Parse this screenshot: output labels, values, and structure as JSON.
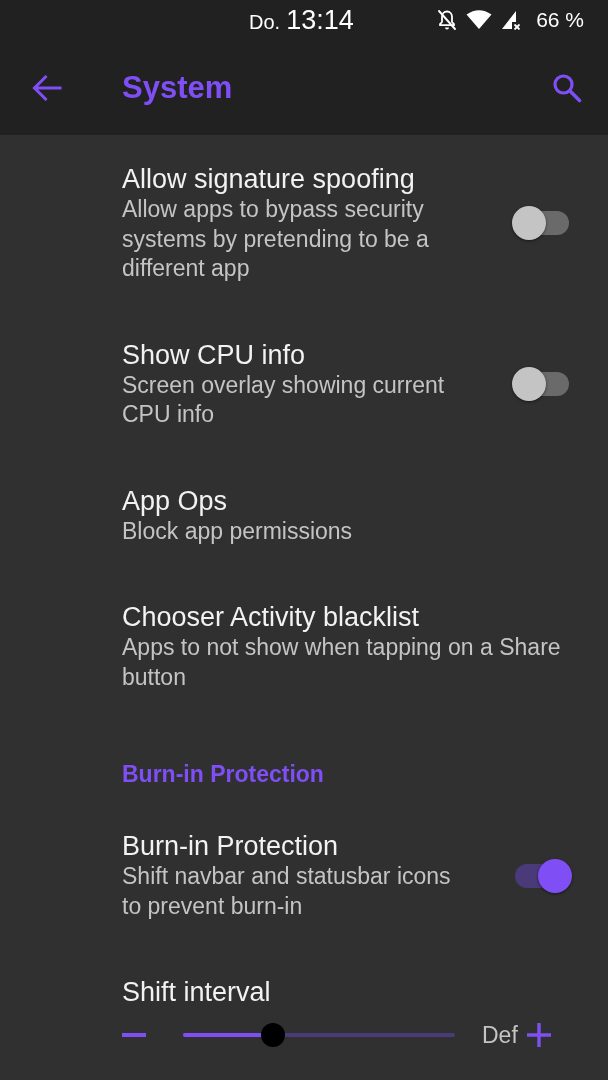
{
  "status_bar": {
    "day": "Do.",
    "time": "13:14",
    "battery": "66 %"
  },
  "app_bar": {
    "title": "System"
  },
  "items": [
    {
      "kind": "switch",
      "title": "Allow signature spoofing",
      "summary": "Allow apps to bypass security systems by pretending to be a different app",
      "on": false
    },
    {
      "kind": "switch",
      "title": "Show CPU info",
      "summary": "Screen overlay showing current CPU info",
      "on": false
    },
    {
      "kind": "link",
      "title": "App Ops",
      "summary": "Block app permissions"
    },
    {
      "kind": "link",
      "title": "Chooser Activity blacklist",
      "summary": "Apps to not show when tapping on a Share button"
    },
    {
      "kind": "header",
      "title": "Burn-in Protection"
    },
    {
      "kind": "switch",
      "title": "Burn-in Protection",
      "summary": "Shift navbar and statusbar icons to prevent burn-in",
      "on": true
    },
    {
      "kind": "slider",
      "title": "Shift interval",
      "level": 0.33,
      "value_label": "Def"
    }
  ]
}
